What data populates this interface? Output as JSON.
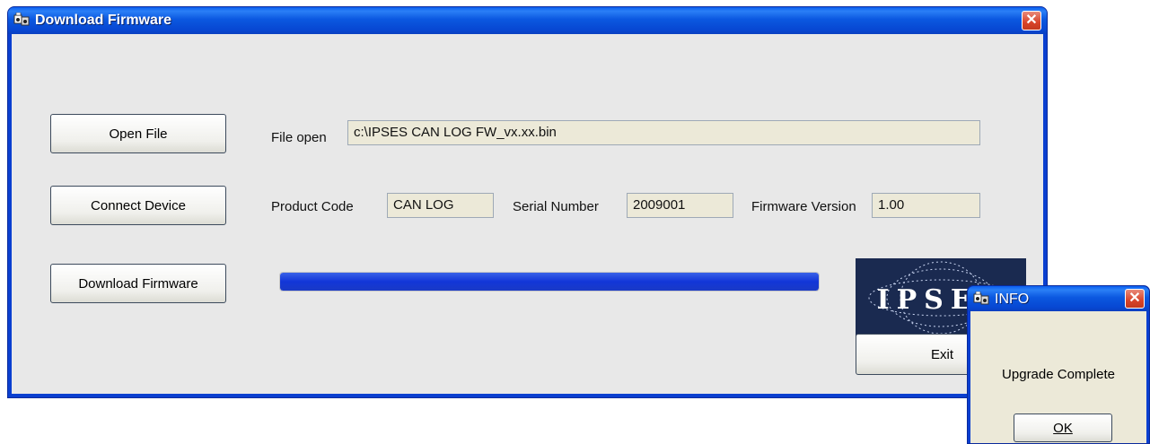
{
  "main_window": {
    "title": "Download Firmware",
    "close_symbol": "✕",
    "buttons": {
      "open_file": "Open File",
      "connect_device": "Connect Device",
      "download_firmware": "Download Firmware",
      "exit": "Exit"
    },
    "file_open": {
      "label": "File open",
      "value": "c:\\IPSES CAN LOG FW_vx.xx.bin"
    },
    "product_code": {
      "label": "Product Code",
      "value": "CAN LOG"
    },
    "serial_number": {
      "label": "Serial Number",
      "value": "2009001"
    },
    "firmware_version": {
      "label": "Firmware Version",
      "value": "1.00"
    },
    "progress": {
      "fraction": 1.0
    },
    "logo_text": "IPSES"
  },
  "info_dialog": {
    "title": "INFO",
    "close_symbol": "✕",
    "message": "Upgrade Complete",
    "ok_label": "OK"
  },
  "colors": {
    "titlebar": "#0747d2",
    "progress": "#1236d8",
    "close": "#d9442a"
  },
  "icons": [
    "app-icon",
    "close-icon",
    "ipses-logo"
  ]
}
